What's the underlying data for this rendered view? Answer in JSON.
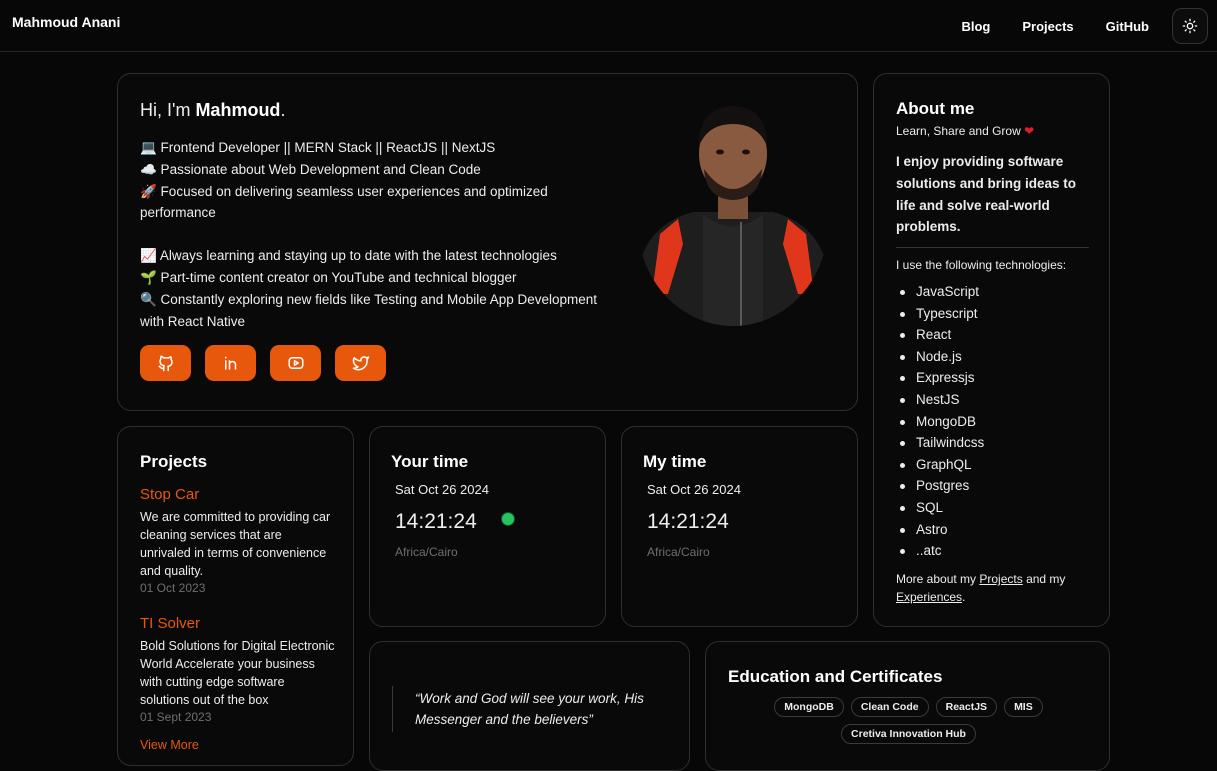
{
  "header": {
    "brand": "Mahmoud Anani",
    "nav": [
      "Blog",
      "Projects",
      "GitHub"
    ],
    "theme_icon": "sun-icon"
  },
  "hero": {
    "greet_prefix": "Hi, I'm ",
    "greet_name": "Mahmoud",
    "greet_suffix": ".",
    "lines": [
      "💻 Frontend Developer || MERN Stack || ReactJS || NextJS",
      "☁️ Passionate about Web Development and Clean Code",
      "🚀 Focused on delivering seamless user experiences and optimized performance",
      "📈 Always learning and staying up to date with the latest technologies",
      "🌱 Part-time content creator on YouTube and technical blogger",
      "🔍 Constantly exploring new fields like Testing and Mobile App Development with React Native"
    ],
    "socials": [
      "github-icon",
      "linkedin-icon",
      "youtube-icon",
      "twitter-icon"
    ],
    "accent": "#e8580c"
  },
  "about": {
    "title": "About me",
    "subtitle": "Learn, Share and Grow",
    "intro": "I enjoy providing software solutions and bring ideas to life and solve real-world problems.",
    "uses_label": "I use the following technologies:",
    "tech": [
      "JavaScript",
      "Typescript",
      "React",
      "Node.js",
      "Expressjs",
      "NestJS",
      "MongoDB",
      "Tailwindcss",
      "GraphQL",
      "Postgres",
      "SQL",
      "Astro",
      "..atc"
    ],
    "more_prefix": "More about my ",
    "more_link1": "Projects",
    "more_mid": " and my ",
    "more_link2": "Experiences",
    "more_suffix": "."
  },
  "projects": {
    "title": "Projects",
    "items": [
      {
        "title": "Stop Car",
        "desc": "We are committed to providing car cleaning services that are unrivaled in terms of convenience and quality.",
        "date": "01 Oct 2023"
      },
      {
        "title": "TI Solver",
        "desc": "Bold Solutions for Digital Electronic World Accelerate your business with cutting edge software solutions out of the box",
        "date": "01 Sept 2023"
      }
    ],
    "view_more": "View More"
  },
  "your_time": {
    "title": "Your time",
    "date": "Sat Oct 26 2024",
    "clock": "14:21:24",
    "zone": "Africa/Cairo"
  },
  "my_time": {
    "title": "My time",
    "date": "Sat Oct 26 2024",
    "clock": "14:21:24",
    "zone": "Africa/Cairo"
  },
  "quote": {
    "text": "“Work and God will see your work, His Messenger and the believers”"
  },
  "education": {
    "title": "Education and Certificates",
    "chips": [
      "MongoDB",
      "Clean Code",
      "ReactJS",
      "MIS",
      "Cretiva Innovation Hub"
    ]
  }
}
